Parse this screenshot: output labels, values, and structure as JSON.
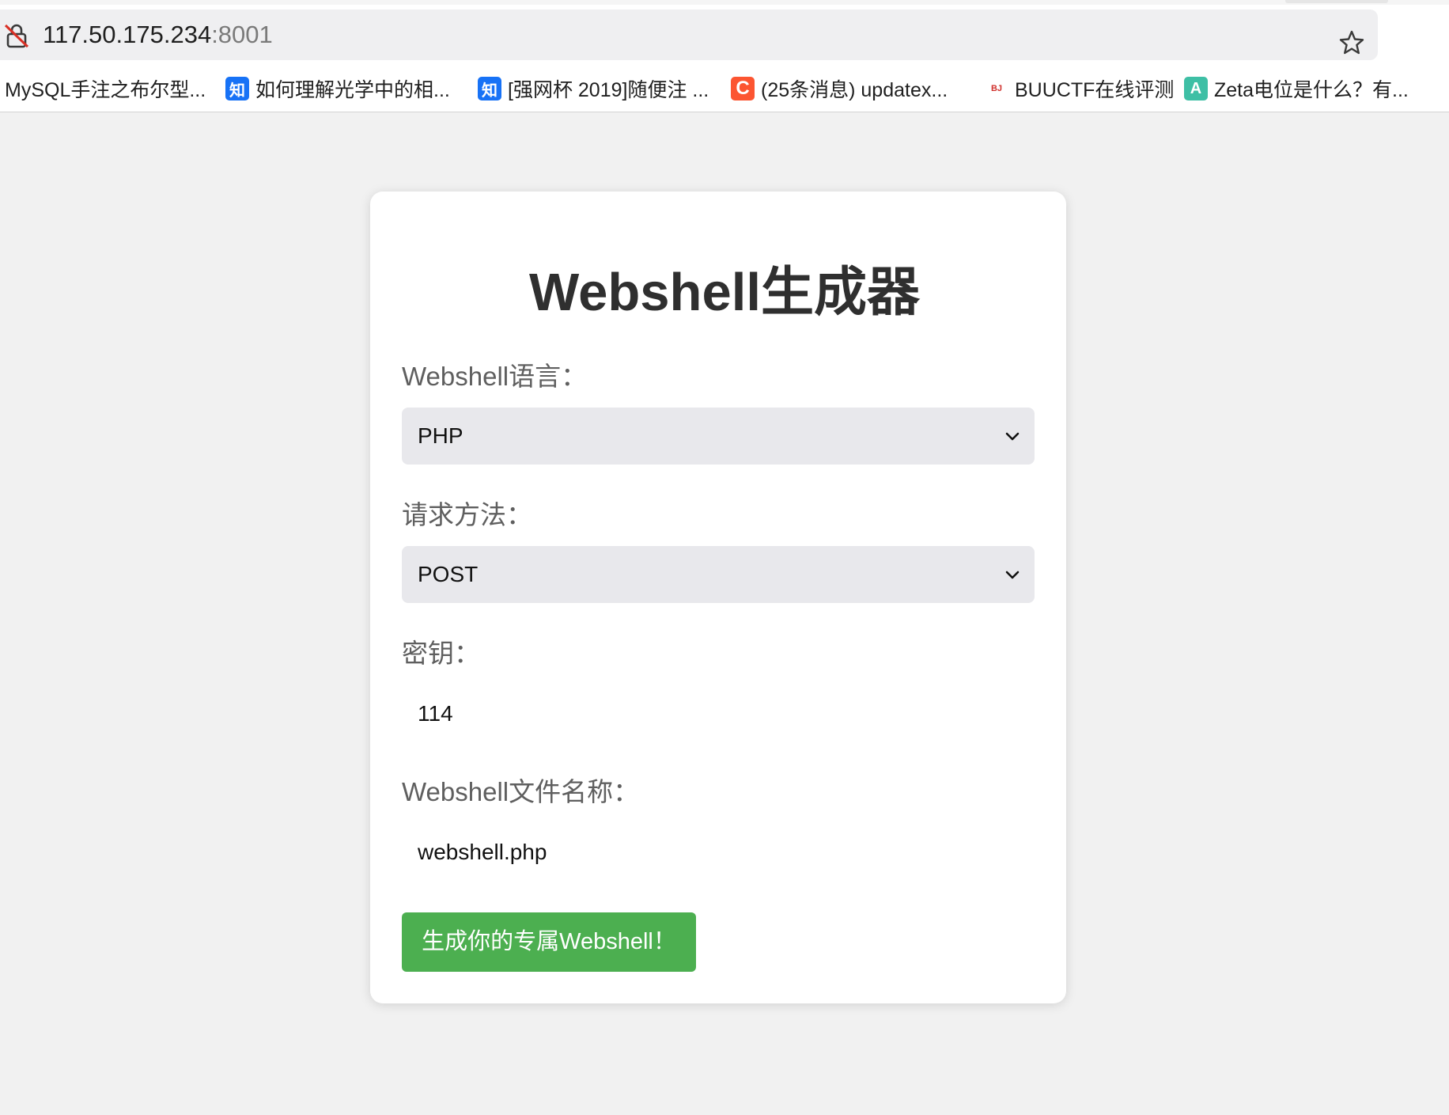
{
  "browser": {
    "url_host": "117.50.175.234",
    "url_port": ":8001",
    "bookmarks": [
      {
        "label": "MySQL手注之布尔型...",
        "icon": "none"
      },
      {
        "label": "如何理解光学中的相...",
        "icon": "zhihu-icon",
        "icon_text": "知"
      },
      {
        "label": "[强网杯 2019]随便注 ...",
        "icon": "zhihu-icon",
        "icon_text": "知"
      },
      {
        "label": "(25条消息) updatex...",
        "icon": "csdn-icon",
        "icon_text": "C"
      },
      {
        "label": "BUUCTF在线评测",
        "icon": "buuctf-icon",
        "icon_text": "BJ"
      },
      {
        "label": "Zeta电位是什么？有...",
        "icon": "zeta-icon",
        "icon_text": "A"
      }
    ]
  },
  "page": {
    "title": "Webshell生成器",
    "language_label": "Webshell语言：",
    "language_value": "PHP",
    "method_label": "请求方法：",
    "method_value": "POST",
    "key_label": "密钥：",
    "key_value": "114",
    "filename_label": "Webshell文件名称：",
    "filename_value": "webshell.php",
    "submit_label": "生成你的专属Webshell！"
  },
  "colors": {
    "button": "#4caf50",
    "select_bg": "#e8e8ec",
    "page_bg": "#f1f1f1"
  }
}
